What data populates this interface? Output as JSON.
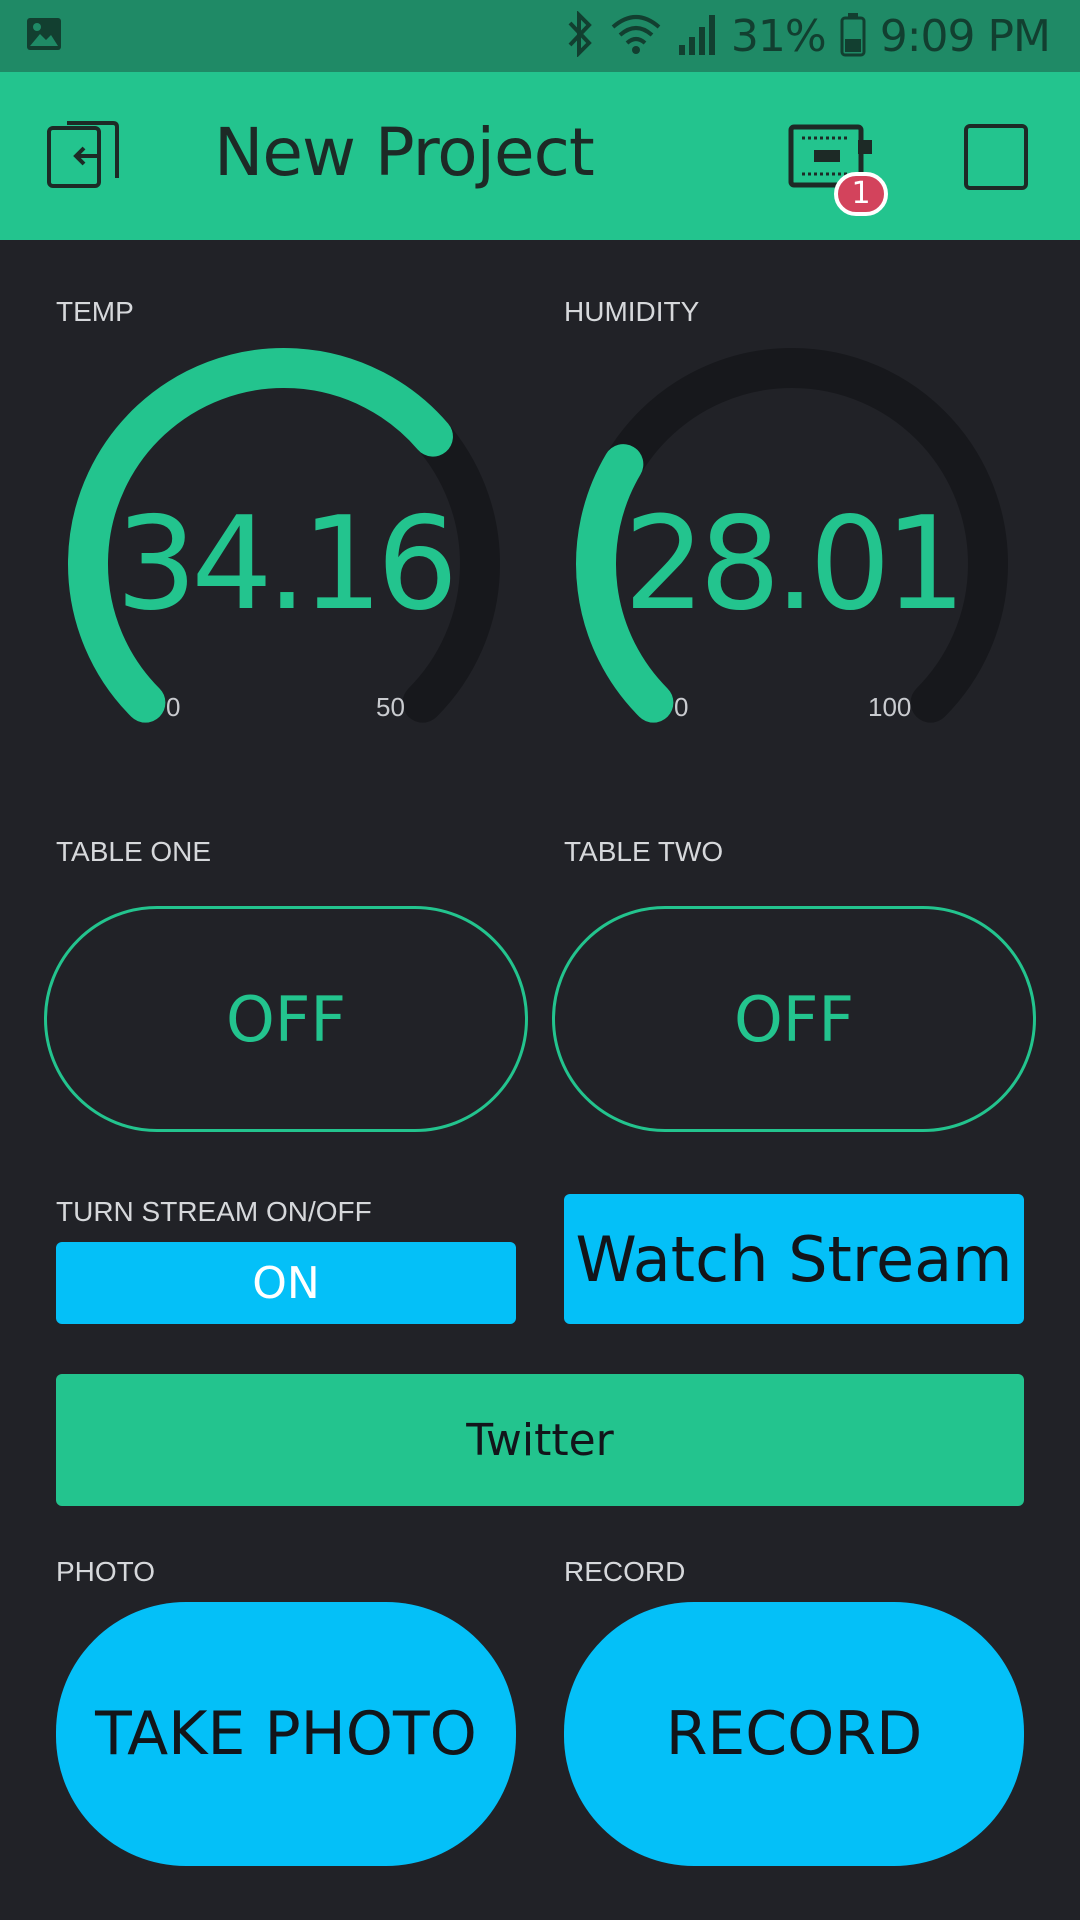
{
  "status_bar": {
    "left_icon": "image-icon",
    "bluetooth_icon": "bluetooth-icon",
    "wifi_icon": "wifi-icon",
    "signal_icon": "signal-icon",
    "battery_percent": "31%",
    "battery_icon": "battery-icon",
    "time": "9:09 PM"
  },
  "app_bar": {
    "back_icon": "exit-project-icon",
    "title": "New Project",
    "device_icon": "device-board-icon",
    "device_badge": "1",
    "play_icon": "stop-square-icon",
    "background_color": "#23c48e"
  },
  "gauges": [
    {
      "label": "TEMP",
      "value": "34.16",
      "min": "0",
      "max": "50",
      "fraction": 0.6832,
      "color": "#23c48e"
    },
    {
      "label": "HUMIDITY",
      "value": "28.01",
      "min": "0",
      "max": "100",
      "fraction": 0.2801,
      "color": "#23c48e"
    }
  ],
  "table_buttons": [
    {
      "label": "TABLE ONE",
      "state": "OFF"
    },
    {
      "label": "TABLE TWO",
      "state": "OFF"
    }
  ],
  "stream": {
    "label": "TURN STREAM ON/OFF",
    "toggle_state": "ON",
    "watch_button": "Watch Stream"
  },
  "twitter": {
    "button": "Twitter"
  },
  "photo": {
    "label": "PHOTO",
    "button": "TAKE PHOTO"
  },
  "record": {
    "label": "RECORD",
    "button": "RECORD"
  },
  "colors": {
    "accent_green": "#23c48e",
    "accent_blue": "#04c0f8",
    "background": "#212227",
    "badge_red": "#d3435c"
  }
}
